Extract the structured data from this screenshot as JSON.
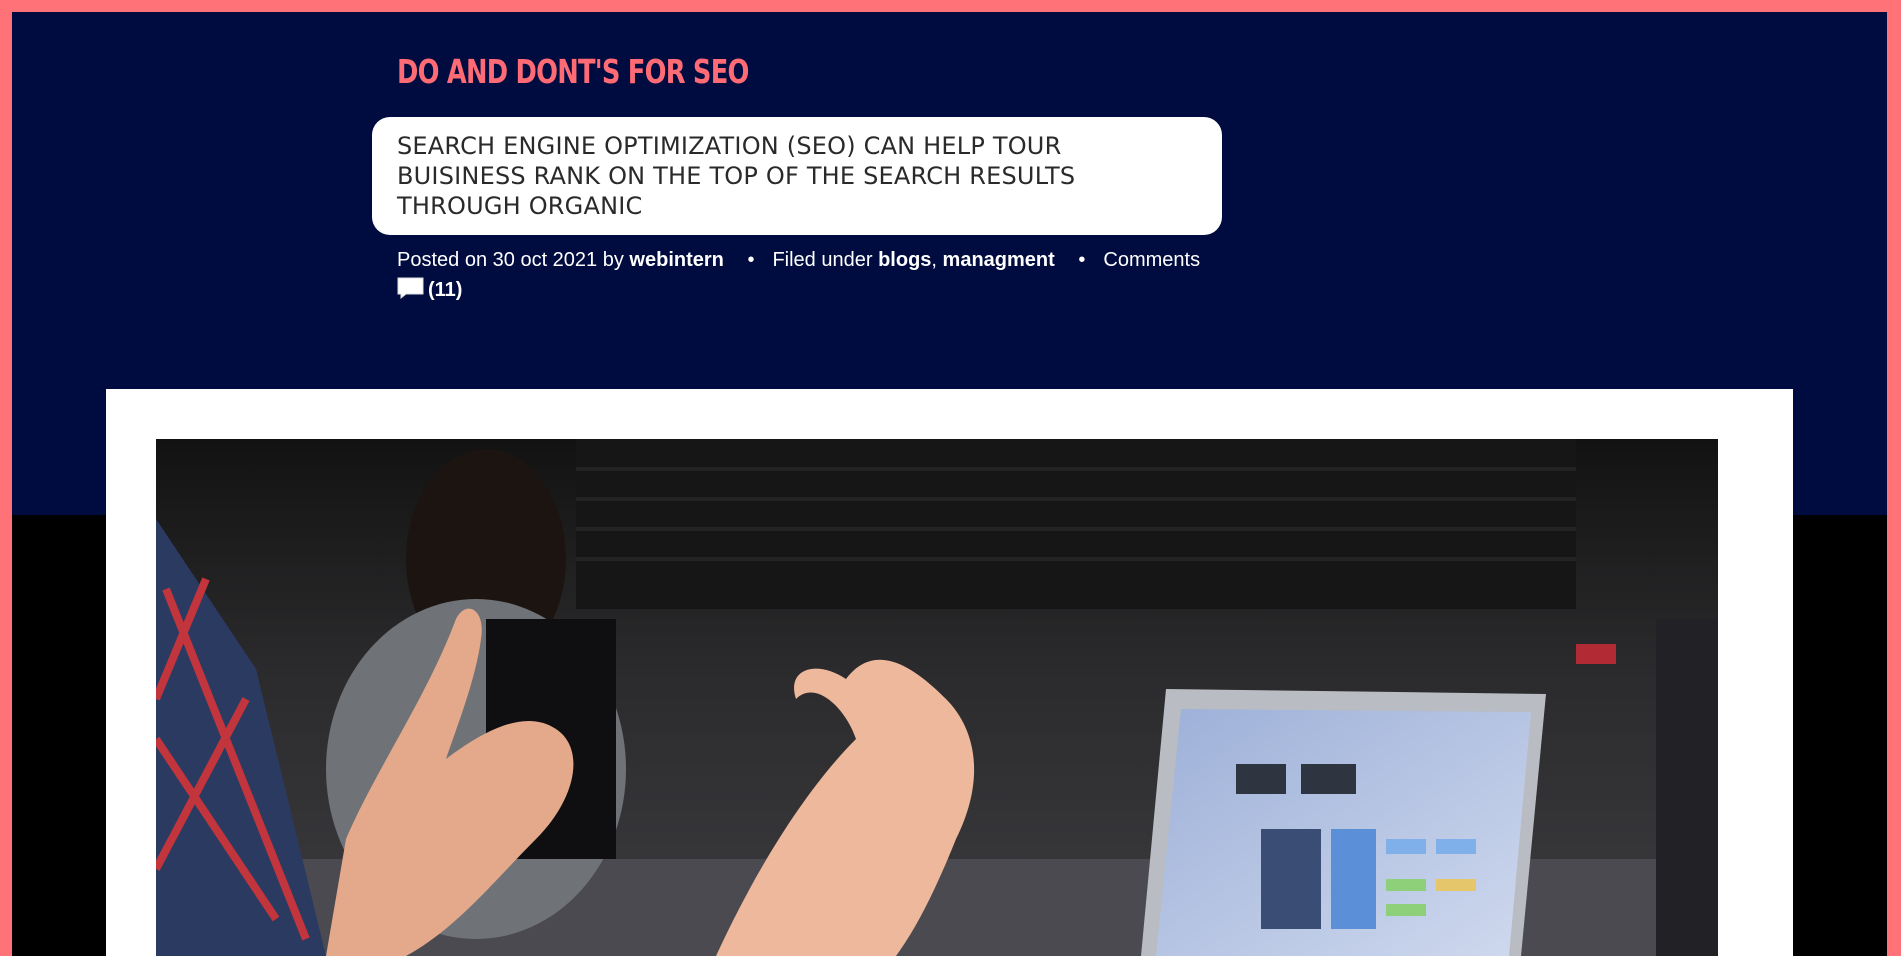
{
  "colors": {
    "frame_border": "#ff7378",
    "hero_background": "#000b3f",
    "title_color": "#ff6b75",
    "page_background": "#000000"
  },
  "post": {
    "title": "DO AND DONT'S FOR SEO",
    "excerpt": "SEARCH ENGINE OPTIMIZATION (SEO) CAN HELP TOUR BUISINESS RANK ON THE TOP OF THE SEARCH RESULTS THROUGH ORGANIC",
    "meta": {
      "posted_prefix": "Posted on",
      "date": "30 oct 2021",
      "by": "by",
      "author": "webintern",
      "separator": "•",
      "filed_prefix": "Filed under",
      "categories": [
        "blogs",
        "managment"
      ],
      "category_separator": ",",
      "comments_label": "Comments",
      "comments_count": "(11)",
      "comments_icon": "comment-bubble-icon"
    }
  },
  "image": {
    "description_icon": "featured-photo"
  }
}
